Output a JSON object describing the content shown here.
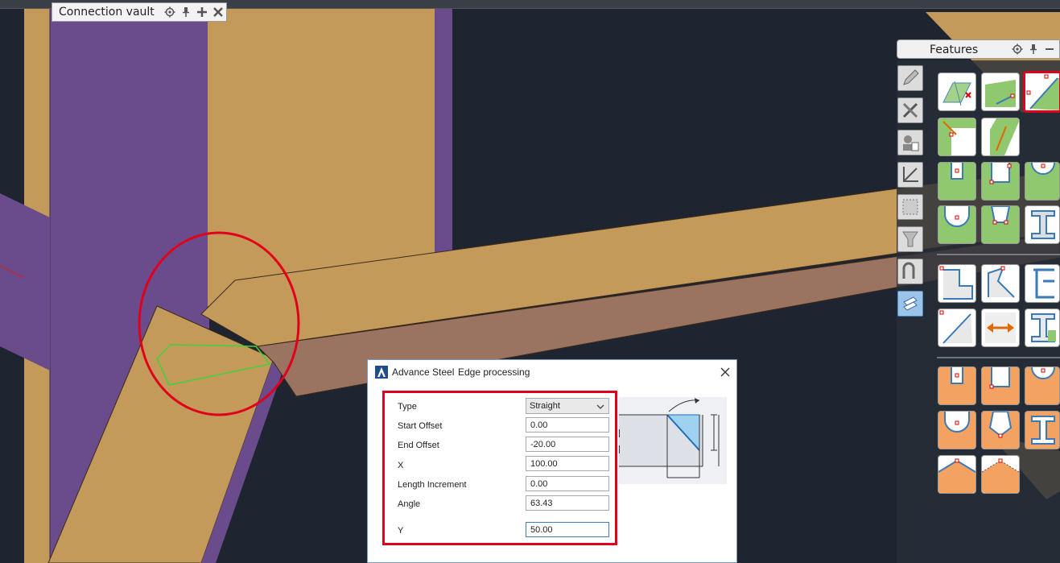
{
  "connection_vault": {
    "title": "Connection vault",
    "icons": [
      "gear-icon",
      "pin-icon",
      "plus-icon",
      "close-icon"
    ]
  },
  "features_palette": {
    "title": "Features",
    "header_icons": [
      "gear-icon",
      "pin-icon",
      "minimize-icon"
    ],
    "categories": [
      "pencil-icon",
      "tools-icon",
      "user-card-icon",
      "axis-icon",
      "rectangle-icon",
      "shield-icon",
      "bend-icon",
      "layers-icon"
    ],
    "active_category": "layers-icon",
    "selected_tool": "edge-processing-tool",
    "colors": {
      "green": "#8fc86e",
      "orange": "#f3a261",
      "selection": "#e0001b"
    }
  },
  "dialog": {
    "app_name": "Advance Steel",
    "title": "Edge processing",
    "fields": {
      "type": {
        "label": "Type",
        "value": "Straight"
      },
      "start_offset": {
        "label": "Start Offset",
        "value": "0.00"
      },
      "end_offset": {
        "label": "End Offset",
        "value": "-20.00"
      },
      "x": {
        "label": "X",
        "value": "100.00"
      },
      "length_increment": {
        "label": "Length Increment",
        "value": "0.00"
      },
      "angle": {
        "label": "Angle",
        "value": "63.43"
      },
      "y": {
        "label": "Y",
        "value": "50.00"
      }
    }
  },
  "colors": {
    "beam_orange": "#c49a5a",
    "column_purple": "#6a4c8c",
    "background": "#1f2530",
    "annotation_red": "#e0001b",
    "edge_green": "#3fd23f"
  }
}
